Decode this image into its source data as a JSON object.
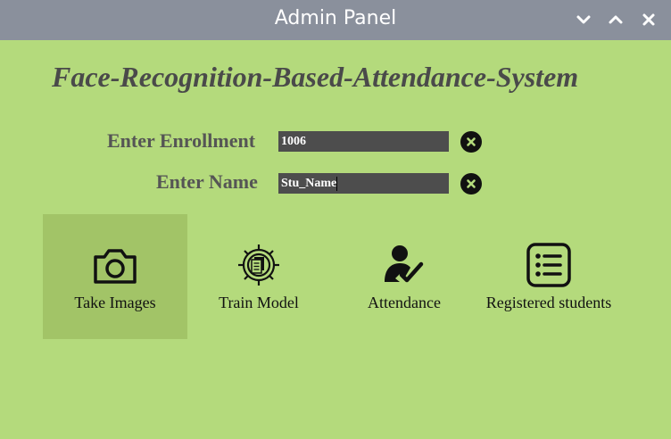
{
  "window": {
    "title": "Admin Panel"
  },
  "heading": "Face-Recognition-Based-Attendance-System",
  "form": {
    "enrollment": {
      "label": "Enter Enrollment",
      "value": "1006"
    },
    "name": {
      "label": "Enter Name",
      "value": "Stu_Name"
    }
  },
  "actions": [
    {
      "label": "Take Images",
      "icon": "camera-icon"
    },
    {
      "label": "Train Model",
      "icon": "gear-document-icon"
    },
    {
      "label": "Attendance",
      "icon": "person-check-icon"
    },
    {
      "label": "Registered students",
      "icon": "list-icon"
    }
  ],
  "colors": {
    "background": "#b4da7c",
    "titlebar": "#8a909c",
    "field": "#4d4d4d",
    "active_tile": "#a2c467"
  }
}
